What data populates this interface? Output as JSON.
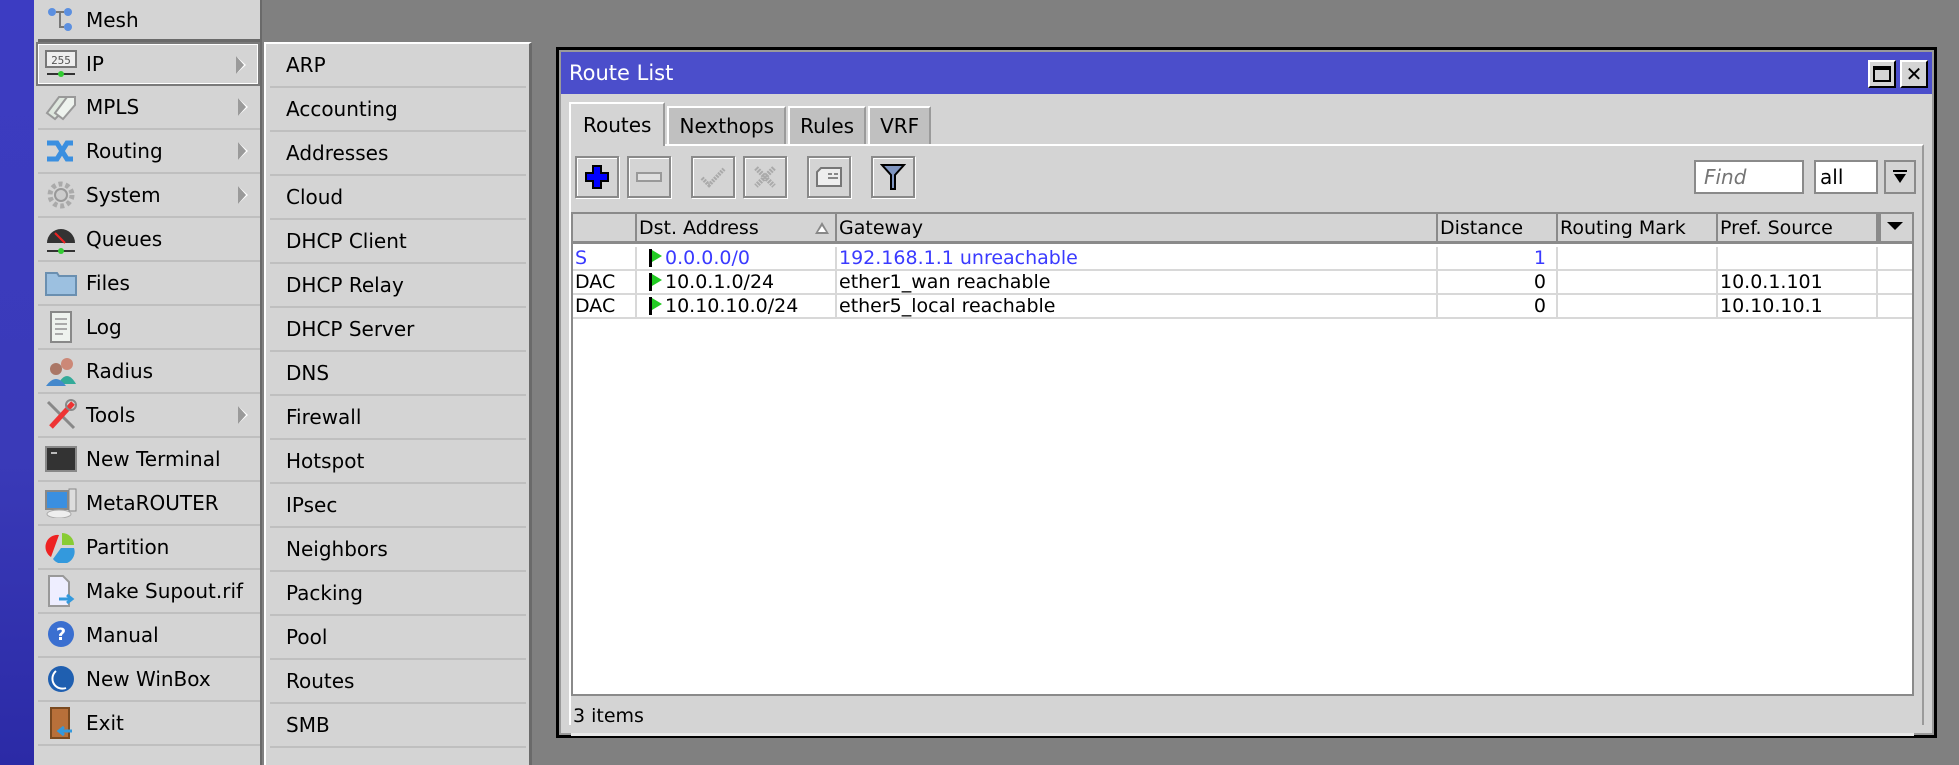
{
  "sidebar": {
    "items": [
      {
        "label": "Mesh",
        "icon": "mesh-icon",
        "submenu": false
      },
      {
        "label": "IP",
        "icon": "ip-icon",
        "submenu": true,
        "active": true
      },
      {
        "label": "MPLS",
        "icon": "mpls-tags-icon",
        "submenu": true
      },
      {
        "label": "Routing",
        "icon": "routing-arrows-icon",
        "submenu": true
      },
      {
        "label": "System",
        "icon": "gear-icon",
        "submenu": true
      },
      {
        "label": "Queues",
        "icon": "queues-gauge-icon",
        "submenu": false
      },
      {
        "label": "Files",
        "icon": "folder-icon",
        "submenu": false
      },
      {
        "label": "Log",
        "icon": "log-document-icon",
        "submenu": false
      },
      {
        "label": "Radius",
        "icon": "users-icon",
        "submenu": false
      },
      {
        "label": "Tools",
        "icon": "tools-icon",
        "submenu": true
      },
      {
        "label": "New Terminal",
        "icon": "terminal-icon",
        "submenu": false
      },
      {
        "label": "MetaROUTER",
        "icon": "metarouter-icon",
        "submenu": false
      },
      {
        "label": "Partition",
        "icon": "pie-chart-icon",
        "submenu": false
      },
      {
        "label": "Make Supout.rif",
        "icon": "file-export-icon",
        "submenu": false
      },
      {
        "label": "Manual",
        "icon": "help-icon",
        "submenu": false
      },
      {
        "label": "New WinBox",
        "icon": "winbox-icon",
        "submenu": false
      },
      {
        "label": "Exit",
        "icon": "exit-door-icon",
        "submenu": false
      }
    ]
  },
  "submenu": {
    "items": [
      "ARP",
      "Accounting",
      "Addresses",
      "Cloud",
      "DHCP Client",
      "DHCP Relay",
      "DHCP Server",
      "DNS",
      "Firewall",
      "Hotspot",
      "IPsec",
      "Neighbors",
      "Packing",
      "Pool",
      "Routes",
      "SMB"
    ]
  },
  "window": {
    "title": "Route List",
    "tabs": [
      "Routes",
      "Nexthops",
      "Rules",
      "VRF"
    ],
    "active_tab": "Routes",
    "find_placeholder": "Find",
    "filter_value": "all",
    "columns": [
      "",
      "Dst. Address",
      "Gateway",
      "Distance",
      "Routing Mark",
      "Pref. Source"
    ],
    "rows": [
      {
        "flags": "S",
        "dst": "0.0.0.0/0",
        "gateway": "192.168.1.1 unreachable",
        "distance": "1",
        "routing_mark": "",
        "pref_source": "",
        "highlight": true
      },
      {
        "flags": "DAC",
        "dst": "10.0.1.0/24",
        "gateway": "ether1_wan reachable",
        "distance": "0",
        "routing_mark": "",
        "pref_source": "10.0.1.101"
      },
      {
        "flags": "DAC",
        "dst": "10.10.10.0/24",
        "gateway": "ether5_local reachable",
        "distance": "0",
        "routing_mark": "",
        "pref_source": "10.10.10.1"
      }
    ],
    "status": "3 items"
  },
  "colors": {
    "titlebar": "#4b4ecb",
    "unreachable_text": "#3a3aff",
    "active_flag": "#22cc22"
  }
}
